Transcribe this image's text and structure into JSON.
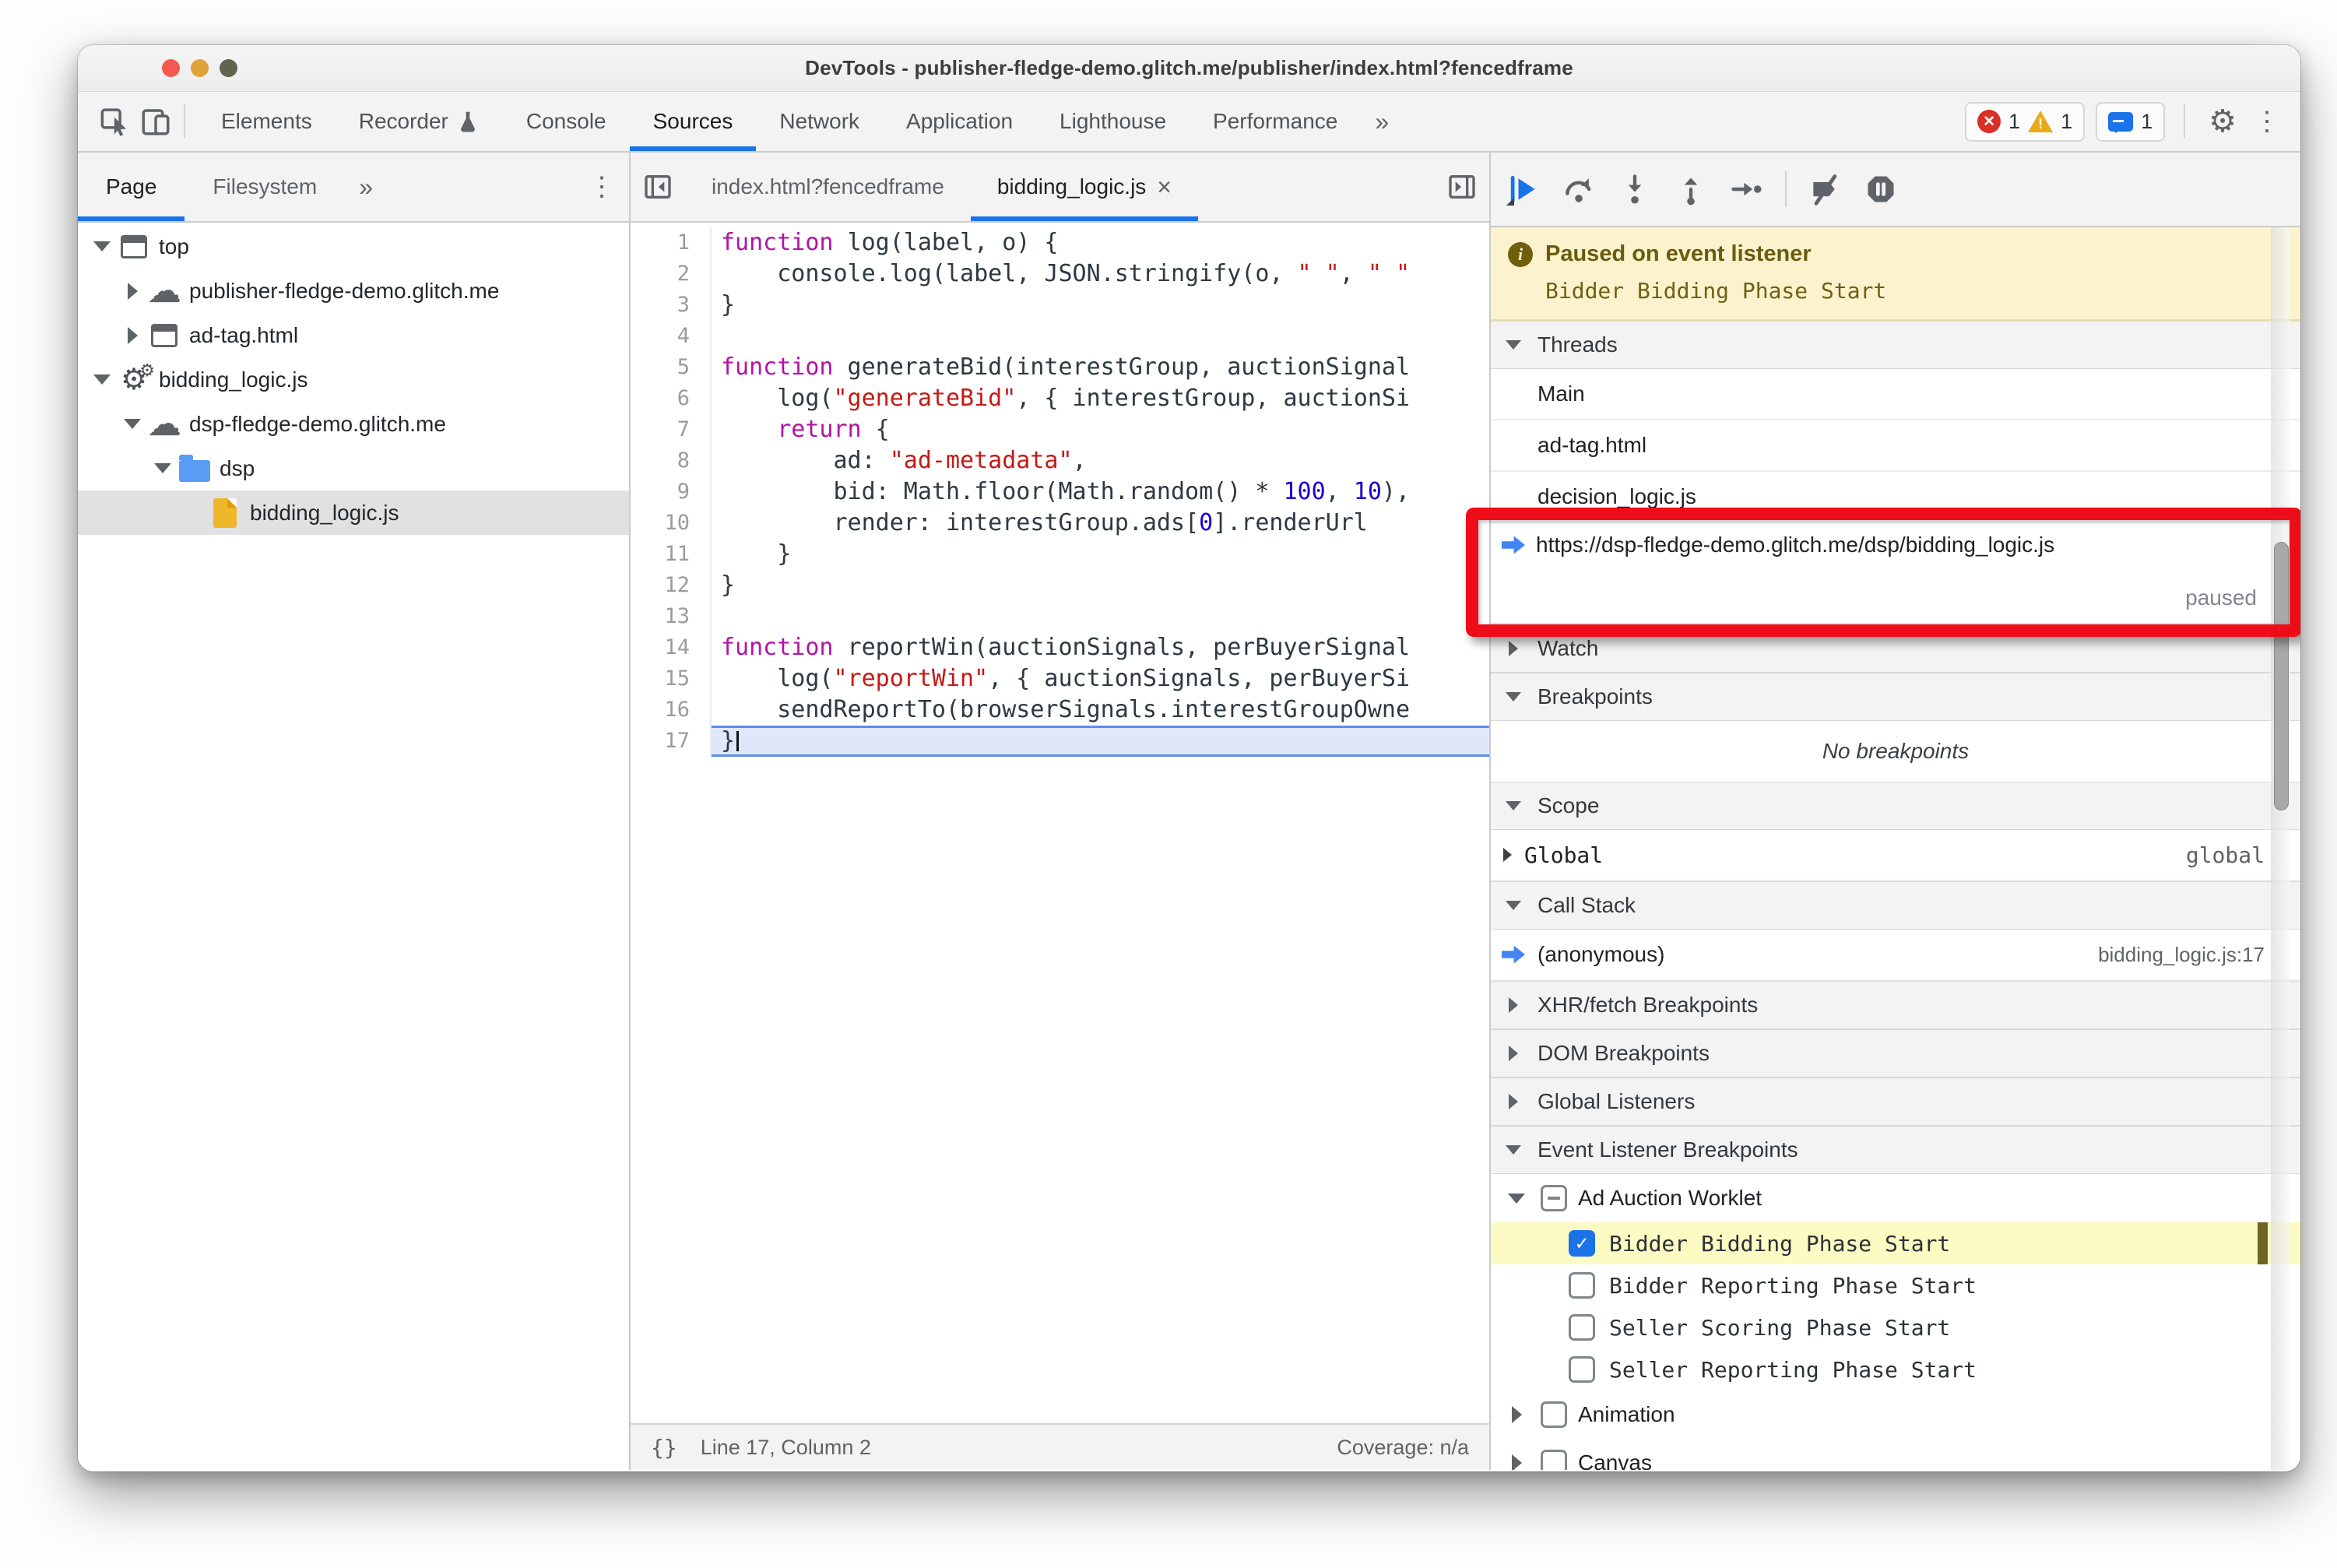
{
  "colors": {
    "accent": "#1a73e8",
    "error_red": "#d93025",
    "warning_yellow": "#e9ab15",
    "annotation_red": "#ee0c19",
    "exec_line_bg": "#dfe8fb",
    "paused_banner_bg": "#fcf3ce",
    "selected_row_gray": "#e1e1e1",
    "highlight_yellow": "#fdfbc4",
    "traffic_lights": [
      "#f25950",
      "#e0a33b",
      "#60644f"
    ]
  },
  "titlebar": {
    "title": "DevTools - publisher-fledge-demo.glitch.me/publisher/index.html?fencedframe"
  },
  "main_toolbar": {
    "tabs": [
      {
        "label": "Elements"
      },
      {
        "label": "Recorder",
        "icon": "flask"
      },
      {
        "label": "Console"
      },
      {
        "label": "Sources",
        "active": true
      },
      {
        "label": "Network"
      },
      {
        "label": "Application"
      },
      {
        "label": "Lighthouse"
      },
      {
        "label": "Performance"
      }
    ],
    "overflow_glyph": "»",
    "badges": {
      "errors": "1",
      "warnings": "1",
      "issues": "1"
    },
    "gear_glyph": "⚙",
    "more_glyph": "⋮"
  },
  "sidebar": {
    "tabs": [
      {
        "label": "Page",
        "active": true
      },
      {
        "label": "Filesystem"
      }
    ],
    "overflow_glyph": "»",
    "more_glyph": "⋮",
    "tree": [
      {
        "label": "top",
        "level": 0,
        "arrow": "down",
        "icon": "frame"
      },
      {
        "label": "publisher-fledge-demo.glitch.me",
        "level": 1,
        "arrow": "right",
        "icon": "cloud"
      },
      {
        "label": "ad-tag.html",
        "level": 1,
        "arrow": "right",
        "icon": "frame"
      },
      {
        "label": "bidding_logic.js",
        "level": 0,
        "arrow": "down",
        "icon": "gear"
      },
      {
        "label": "dsp-fledge-demo.glitch.me",
        "level": 1,
        "arrow": "down",
        "icon": "cloud"
      },
      {
        "label": "dsp",
        "level": 2,
        "arrow": "down",
        "icon": "folder"
      },
      {
        "label": "bidding_logic.js",
        "level": 3,
        "arrow": "none",
        "icon": "file",
        "selected": true
      }
    ]
  },
  "editor": {
    "tabs": [
      {
        "label": "index.html?fencedframe"
      },
      {
        "label": "bidding_logic.js",
        "active": true,
        "close_glyph": "×"
      }
    ],
    "lines": [
      {
        "n": 1,
        "tokens": [
          {
            "c": "kw",
            "v": "function"
          },
          {
            "c": "",
            "v": " log(label, o) {"
          }
        ]
      },
      {
        "n": 2,
        "tokens": [
          {
            "c": "",
            "v": "    console.log(label, JSON.stringify(o, "
          },
          {
            "c": "str",
            "v": "\" \""
          },
          {
            "c": "",
            "v": ", "
          },
          {
            "c": "str",
            "v": "\" \""
          }
        ]
      },
      {
        "n": 3,
        "tokens": [
          {
            "c": "",
            "v": "}"
          }
        ]
      },
      {
        "n": 4,
        "tokens": []
      },
      {
        "n": 5,
        "tokens": [
          {
            "c": "kw",
            "v": "function"
          },
          {
            "c": "",
            "v": " generateBid(interestGroup, auctionSignal"
          }
        ]
      },
      {
        "n": 6,
        "tokens": [
          {
            "c": "",
            "v": "    log("
          },
          {
            "c": "str",
            "v": "\"generateBid\""
          },
          {
            "c": "",
            "v": ", { interestGroup, auctionSi"
          }
        ]
      },
      {
        "n": 7,
        "tokens": [
          {
            "c": "",
            "v": "    "
          },
          {
            "c": "kw",
            "v": "return"
          },
          {
            "c": "",
            "v": " {"
          }
        ]
      },
      {
        "n": 8,
        "tokens": [
          {
            "c": "",
            "v": "        ad: "
          },
          {
            "c": "str",
            "v": "\"ad-metadata\""
          },
          {
            "c": "",
            "v": ","
          }
        ]
      },
      {
        "n": 9,
        "tokens": [
          {
            "c": "",
            "v": "        bid: Math.floor(Math.random() * "
          },
          {
            "c": "num",
            "v": "100"
          },
          {
            "c": "",
            "v": ", "
          },
          {
            "c": "num",
            "v": "10"
          },
          {
            "c": "",
            "v": "),"
          }
        ]
      },
      {
        "n": 10,
        "tokens": [
          {
            "c": "",
            "v": "        render: interestGroup.ads["
          },
          {
            "c": "num",
            "v": "0"
          },
          {
            "c": "",
            "v": "].renderUrl"
          }
        ]
      },
      {
        "n": 11,
        "tokens": [
          {
            "c": "",
            "v": "    }"
          }
        ]
      },
      {
        "n": 12,
        "tokens": [
          {
            "c": "",
            "v": "}"
          }
        ]
      },
      {
        "n": 13,
        "tokens": []
      },
      {
        "n": 14,
        "tokens": [
          {
            "c": "kw",
            "v": "function"
          },
          {
            "c": "",
            "v": " reportWin(auctionSignals, perBuyerSignal"
          }
        ]
      },
      {
        "n": 15,
        "tokens": [
          {
            "c": "",
            "v": "    log("
          },
          {
            "c": "str",
            "v": "\"reportWin\""
          },
          {
            "c": "",
            "v": ", { auctionSignals, perBuyerSi"
          }
        ]
      },
      {
        "n": 16,
        "tokens": [
          {
            "c": "",
            "v": "    sendReportTo(browserSignals.interestGroupOwne"
          }
        ]
      },
      {
        "n": 17,
        "tokens": [
          {
            "c": "",
            "v": "}"
          }
        ],
        "exec": true
      }
    ],
    "status": {
      "braces_glyph": "{}",
      "position": "Line 17, Column 2",
      "coverage": "Coverage: n/a"
    }
  },
  "debugger": {
    "toolbar_buttons": [
      "resume",
      "step-over",
      "step-into",
      "step-out",
      "step",
      "divider",
      "deactivate-breakpoints",
      "pause-exceptions"
    ],
    "banner": {
      "info_glyph": "i",
      "title": "Paused on event listener",
      "detail": "Bidder Bidding Phase Start"
    },
    "blocks": [
      {
        "type": "header",
        "label": "Threads",
        "expanded": true
      },
      {
        "type": "thread",
        "label": "Main"
      },
      {
        "type": "thread",
        "label": "ad-tag.html"
      },
      {
        "type": "thread",
        "label": "decision_logic.js"
      },
      {
        "type": "thread-paused",
        "label": "https://dsp-fledge-demo.glitch.me/dsp/bidding_logic.js",
        "status": "paused"
      },
      {
        "type": "header",
        "label": "Watch",
        "expanded": false
      },
      {
        "type": "header",
        "label": "Breakpoints",
        "expanded": true
      },
      {
        "type": "note",
        "label": "No breakpoints"
      },
      {
        "type": "header",
        "label": "Scope",
        "expanded": true
      },
      {
        "type": "scope",
        "name": "Global",
        "value": "global"
      },
      {
        "type": "header",
        "label": "Call Stack",
        "expanded": true
      },
      {
        "type": "stack",
        "name": "(anonymous)",
        "location": "bidding_logic.js:17"
      },
      {
        "type": "header",
        "label": "XHR/fetch Breakpoints",
        "expanded": false
      },
      {
        "type": "header",
        "label": "DOM Breakpoints",
        "expanded": false
      },
      {
        "type": "header",
        "label": "Global Listeners",
        "expanded": false
      },
      {
        "type": "header",
        "label": "Event Listener Breakpoints",
        "expanded": true
      },
      {
        "type": "elb-group",
        "label": "Ad Auction Worklet",
        "check": "indeterminate",
        "expanded": true
      },
      {
        "type": "elb-item",
        "label": "Bidder Bidding Phase Start",
        "checked": true,
        "highlighted": true
      },
      {
        "type": "elb-item",
        "label": "Bidder Reporting Phase Start",
        "checked": false
      },
      {
        "type": "elb-item",
        "label": "Seller Scoring Phase Start",
        "checked": false
      },
      {
        "type": "elb-item",
        "label": "Seller Reporting Phase Start",
        "checked": false
      },
      {
        "type": "elb-group",
        "label": "Animation",
        "check": "unchecked",
        "expanded": false
      },
      {
        "type": "elb-group",
        "label": "Canvas",
        "check": "unchecked",
        "expanded": false
      }
    ]
  }
}
